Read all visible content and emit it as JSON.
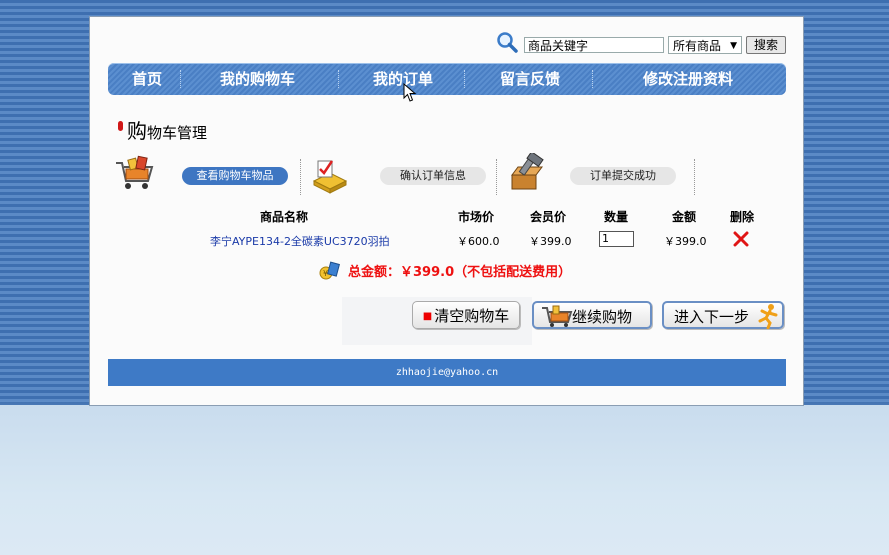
{
  "search": {
    "keyword_value": "商品关键字",
    "category_selected": "所有商品",
    "button_label": "搜索"
  },
  "nav": {
    "items": [
      "首页",
      "我的购物车",
      "我的订单",
      "留言反馈",
      "修改注册资料"
    ]
  },
  "page": {
    "title_first": "购",
    "title_rest": "物车管理"
  },
  "steps": [
    {
      "label": "查看购物车物品",
      "active": true
    },
    {
      "label": "确认订单信息",
      "active": false
    },
    {
      "label": "订单提交成功",
      "active": false
    }
  ],
  "table": {
    "headers": [
      "商品名称",
      "市场价",
      "会员价",
      "数量",
      "金额",
      "删除"
    ],
    "rows": [
      {
        "name": "李宁AYPE134-2全碳素UC3720羽拍",
        "market_price": "￥600.0",
        "member_price": "￥399.0",
        "quantity": "1",
        "amount": "￥399.0"
      }
    ]
  },
  "total": {
    "text": "总金额：￥399.0（不包括配送费用）"
  },
  "actions": {
    "clear": "清空购物车",
    "continue": "继续购物",
    "next": "进入下一步"
  },
  "footer": {
    "email": "zhhaojie@yahoo.cn"
  },
  "colors": {
    "nav_blue": "#4a7fc4",
    "footer_blue": "#3e7ac6",
    "total_red": "#e11111",
    "link_blue": "#1a3aa8"
  }
}
